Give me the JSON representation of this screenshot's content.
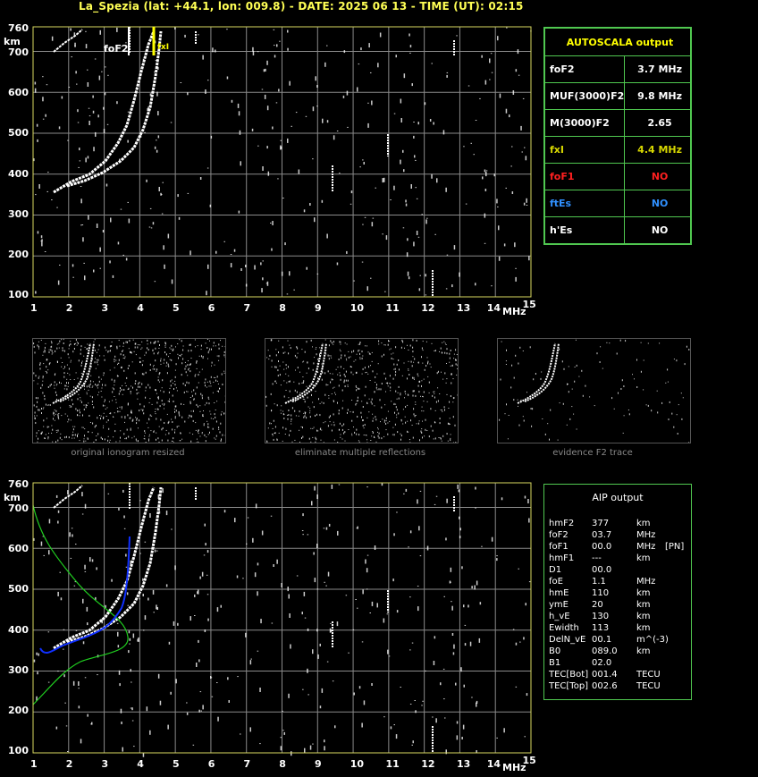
{
  "header": {
    "title": "La_Spezia (lat: +44.1, lon: 009.8) - DATE: 2025 06 13 - TIME (UT): 02:15"
  },
  "axes": {
    "y_unit": "km",
    "x_unit": "MHz",
    "y_ticks": [
      "760",
      "700",
      "600",
      "500",
      "400",
      "300",
      "200",
      "100"
    ],
    "x_ticks": [
      "1",
      "2",
      "3",
      "4",
      "5",
      "6",
      "7",
      "8",
      "9",
      "10",
      "11",
      "12",
      "13",
      "14",
      "15"
    ]
  },
  "markers": {
    "foF2": "foF2",
    "fxI": "fxI"
  },
  "autoscala": {
    "title": "AUTOSCALA output",
    "rows": [
      {
        "label": "foF2",
        "value": "3.7 MHz",
        "color": "#ffffff"
      },
      {
        "label": "MUF(3000)F2",
        "value": "9.8 MHz",
        "color": "#ffffff"
      },
      {
        "label": "M(3000)F2",
        "value": "2.65",
        "color": "#ffffff"
      },
      {
        "label": "fxI",
        "value": "4.4 MHz",
        "color": "#d8d800"
      },
      {
        "label": "foF1",
        "value": "NO",
        "color": "#ff2020"
      },
      {
        "label": "ftEs",
        "value": "NO",
        "color": "#3090ff"
      },
      {
        "label": "h'Es",
        "value": "NO",
        "color": "#ffffff"
      }
    ]
  },
  "thumbnails": {
    "captions": [
      "original ionogram resized",
      "eliminate multiple reflections",
      "evidence F2 trace"
    ]
  },
  "aip": {
    "title": "AIP output",
    "rows": [
      {
        "name": "hmF2",
        "value": "377",
        "unit": "km",
        "extra": ""
      },
      {
        "name": "foF2",
        "value": "03.7",
        "unit": "MHz",
        "extra": ""
      },
      {
        "name": "foF1",
        "value": "00.0",
        "unit": "MHz",
        "extra": "[PN]"
      },
      {
        "name": "hmF1",
        "value": "---",
        "unit": "km",
        "extra": ""
      },
      {
        "name": "D1",
        "value": "00.0",
        "unit": "",
        "extra": ""
      },
      {
        "name": "foE",
        "value": "1.1",
        "unit": "MHz",
        "extra": ""
      },
      {
        "name": "hmE",
        "value": "110",
        "unit": "km",
        "extra": ""
      },
      {
        "name": "ymE",
        "value": "20",
        "unit": "km",
        "extra": ""
      },
      {
        "name": "h_vE",
        "value": "130",
        "unit": "km",
        "extra": ""
      },
      {
        "name": "Ewidth",
        "value": "113",
        "unit": "km",
        "extra": ""
      },
      {
        "name": "DelN_vE",
        "value": "00.1",
        "unit": "m^(-3)",
        "extra": ""
      },
      {
        "name": "B0",
        "value": "089.0",
        "unit": "km",
        "extra": ""
      },
      {
        "name": "B1",
        "value": "02.0",
        "unit": "",
        "extra": ""
      },
      {
        "name": "TEC[Bot]",
        "value": "001.4",
        "unit": "TECU",
        "extra": ""
      },
      {
        "name": "TEC[Top]",
        "value": "002.6",
        "unit": "TECU",
        "extra": ""
      }
    ]
  },
  "colors": {
    "grid": "#8a8a8a",
    "axis_frame": "#d8d860",
    "panel_border": "#50c850",
    "profile_curve": "#20d020",
    "trace_fit": "#1030ff"
  }
}
